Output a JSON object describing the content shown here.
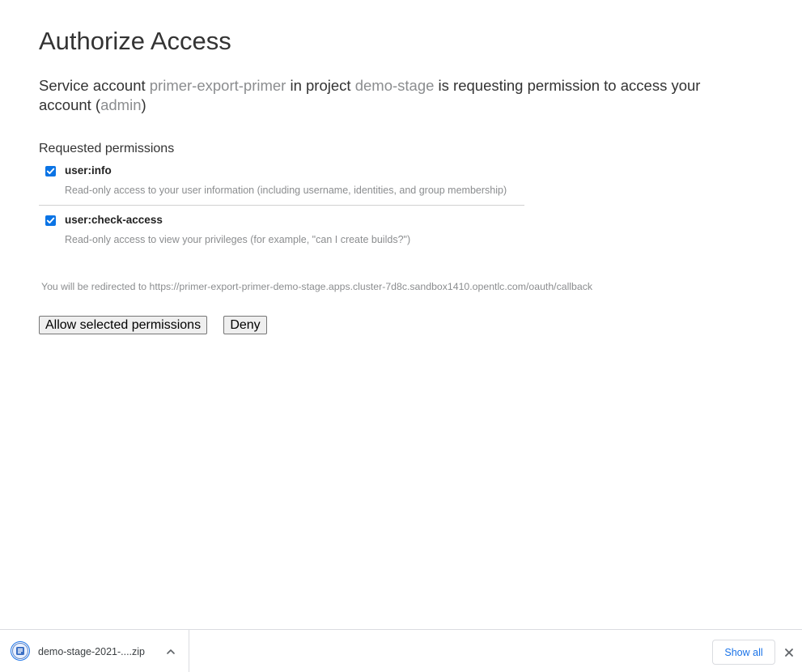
{
  "page": {
    "title": "Authorize Access",
    "intro": {
      "part1": "Service account ",
      "service_account": "primer-export-primer",
      "part2": " in project ",
      "project": "demo-stage",
      "part3": " is requesting permission to access your account (",
      "user": "admin",
      "part4": ")"
    },
    "permissions_heading": "Requested permissions",
    "permissions": [
      {
        "name": "user:info",
        "description": "Read-only access to your user information (including username, identities, and group membership)",
        "checked": true
      },
      {
        "name": "user:check-access",
        "description": "Read-only access to view your privileges (for example, \"can I create builds?\")",
        "checked": true
      }
    ],
    "redirect_text": "You will be redirected to https://primer-export-primer-demo-stage.apps.cluster-7d8c.sandbox1410.opentlc.com/oauth/callback",
    "allow_label": "Allow selected permissions",
    "deny_label": "Deny"
  },
  "download_bar": {
    "file_name": "demo-stage-2021-....zip",
    "show_all_label": "Show all",
    "icon": "zip-file-icon",
    "accent": "#1a73e8"
  },
  "colors": {
    "checkbox": "#0b74e5",
    "muted_text": "#8b8d8f"
  }
}
